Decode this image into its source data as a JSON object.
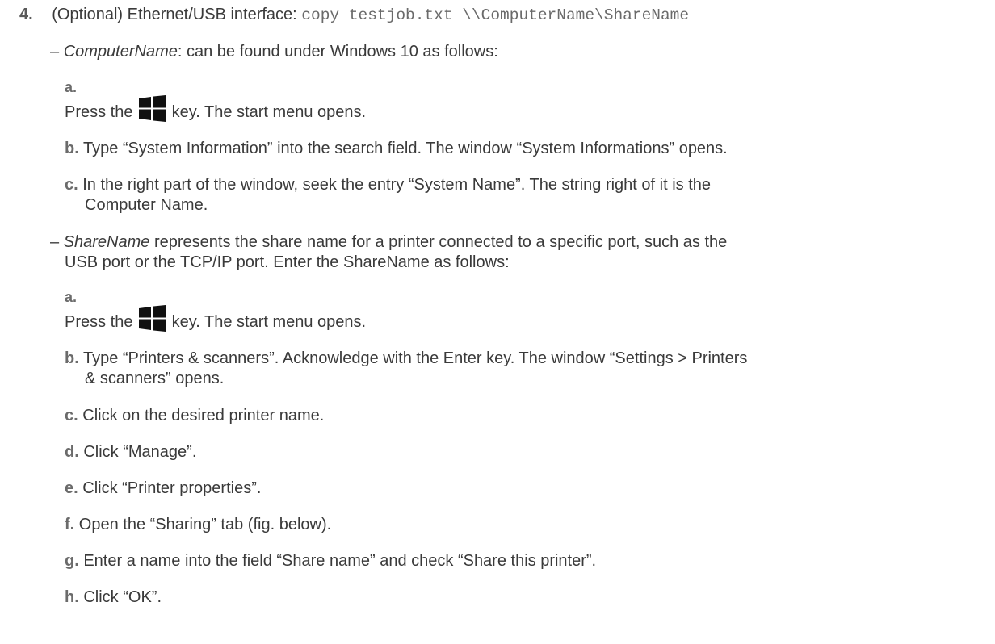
{
  "step4": {
    "number": "4.",
    "text": "(Optional) Ethernet/USB interface:",
    "command": "copy testjob.txt \\\\ComputerName\\ShareName"
  },
  "computer_name": {
    "dash": "–",
    "term": "ComputerName",
    "text": ": can be found under Windows 10 as follows:",
    "steps": [
      {
        "letter": "a.",
        "pre": "Press the",
        "icon": "windows-logo-icon",
        "post": "key. The start menu opens."
      },
      {
        "letter": "b.",
        "text": "Type “System Information” into the search field. The window “System Informations” opens."
      },
      {
        "letter": "c.",
        "text1": "In the right part of the window, seek the entry “System Name”. The string right of it is the",
        "text2": "Computer Name."
      }
    ]
  },
  "share_name": {
    "dash": "–",
    "term": "ShareName",
    "text1": " represents the share name for a printer connected to a specific port, such as the",
    "text2": "USB port or the TCP/IP port. Enter the ShareName as follows:",
    "steps": [
      {
        "letter": "a.",
        "pre": "Press the",
        "icon": "windows-logo-icon",
        "post": "key. The start menu opens."
      },
      {
        "letter": "b.",
        "text1": "Type “Printers & scanners”. Acknowledge with the Enter key. The window “Settings > Printers",
        "text2": "& scanners” opens."
      },
      {
        "letter": "c.",
        "text": "Click on the desired printer name."
      },
      {
        "letter": "d.",
        "text": "Click “Manage”."
      },
      {
        "letter": "e.",
        "text": "Click “Printer properties”."
      },
      {
        "letter": "f.",
        "text": "Open the “Sharing” tab (fig. below)."
      },
      {
        "letter": "g.",
        "text": "Enter a name into the field “Share name” and check “Share this printer”."
      },
      {
        "letter": "h.",
        "text": "Click “OK”."
      }
    ]
  }
}
